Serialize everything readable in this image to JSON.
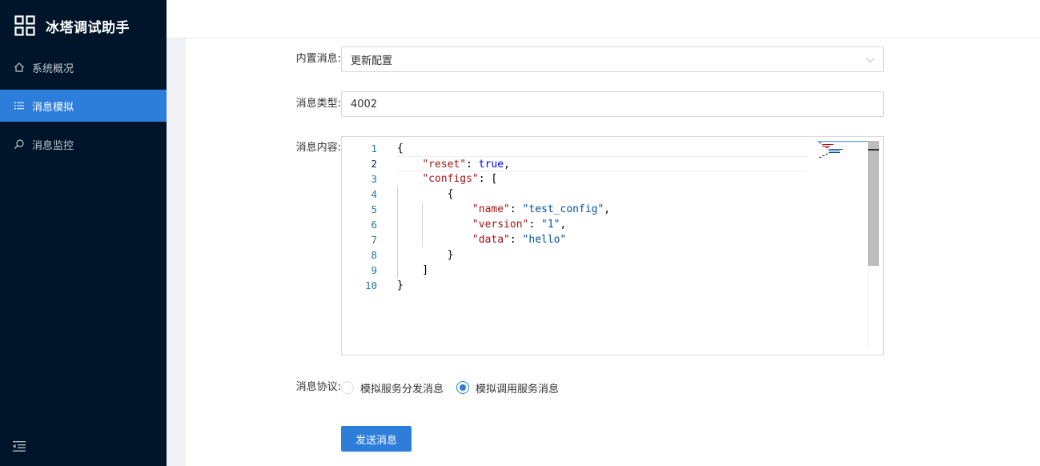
{
  "app": {
    "title": "冰塔调试助手"
  },
  "sidebar": {
    "items": [
      {
        "label": "系统概况",
        "icon": "home-icon",
        "active": false
      },
      {
        "label": "消息模拟",
        "icon": "list-icon",
        "active": true
      },
      {
        "label": "消息监控",
        "icon": "search-icon",
        "active": false
      }
    ],
    "collapse_icon": "menu-fold-icon"
  },
  "form": {
    "builtin_message": {
      "label": "内置消息:",
      "value": "更新配置"
    },
    "message_type": {
      "label": "消息类型:",
      "value": "4002"
    },
    "message_content": {
      "label": "消息内容:",
      "line_numbers": [
        "1",
        "2",
        "3",
        "4",
        "5",
        "6",
        "7",
        "8",
        "9",
        "10"
      ],
      "current_line": 2
    },
    "protocol": {
      "label": "消息协议:",
      "options": [
        {
          "label": "模拟服务分发消息",
          "checked": false
        },
        {
          "label": "模拟调用服务消息",
          "checked": true
        }
      ]
    },
    "submit_label": "发送消息"
  },
  "colors": {
    "sidebar_bg": "#001529",
    "accent": "#2d7ddb",
    "json_key": "#a31515",
    "json_string": "#0451a5",
    "json_bool": "#0000ff"
  }
}
